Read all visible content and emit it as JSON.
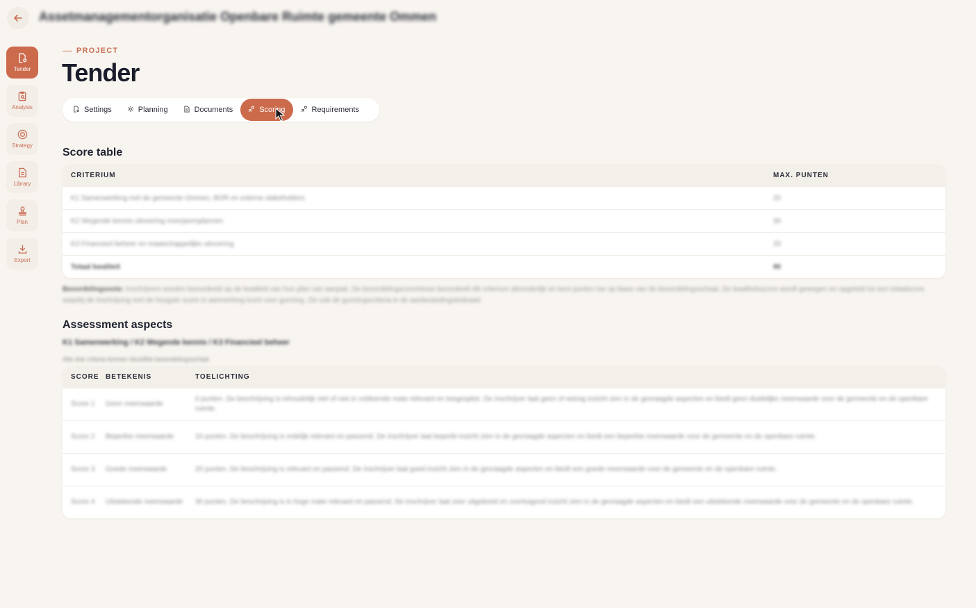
{
  "topbar": {
    "back_icon": "arrow-left-icon",
    "org_title": "Assetmanagementorganisatie Openbare Ruimte gemeente Ommen"
  },
  "sidebar": {
    "items": [
      {
        "label": "Tender",
        "icon": "document-settings-icon",
        "active": true
      },
      {
        "label": "Analysis",
        "icon": "clipboard-search-icon",
        "active": false
      },
      {
        "label": "Strategy",
        "icon": "target-icon",
        "active": false
      },
      {
        "label": "Library",
        "icon": "document-icon",
        "active": false
      },
      {
        "label": "Plan",
        "icon": "stamp-icon",
        "active": false
      },
      {
        "label": "Export",
        "icon": "download-icon",
        "active": false
      }
    ]
  },
  "header": {
    "eyebrow": "PROJECT",
    "title": "Tender"
  },
  "tabs": [
    {
      "label": "Settings",
      "icon": "document-settings-icon"
    },
    {
      "label": "Planning",
      "icon": "gear-icon"
    },
    {
      "label": "Documents",
      "icon": "document-icon"
    },
    {
      "label": "Scoring",
      "icon": "scoring-icon",
      "active": true
    },
    {
      "label": "Requirements",
      "icon": "scoring-icon"
    }
  ],
  "score_table": {
    "heading": "Score table",
    "columns": [
      "CRITERIUM",
      "MAX. PUNTEN"
    ],
    "rows": [
      {
        "criterium": "K1 Samenwerking met de gemeente Ommen, BOR en externe stakeholders",
        "punten": "20"
      },
      {
        "criterium": "K2 Wegende kennis uitvoering meerjarenplannen",
        "punten": "30"
      },
      {
        "criterium": "K3 Financieel beheer en maatschappelijke uitvoering",
        "punten": "20"
      },
      {
        "criterium": "Totaal kwaliteit",
        "punten": "90"
      }
    ]
  },
  "note": {
    "label": "Beoordelingsnote:",
    "text": " Inschrijvers worden beoordeeld op de kwaliteit van hun plan van aanpak. De beoordelingscommissie beoordeelt elk criterium afzonderlijk en kent punten toe op basis van de beoordelingsschaal. De kwaliteitsscore wordt gewogen en opgeteld tot een totaalscore waarbij de inschrijving met de hoogste score in aanmerking komt voor gunning. Zie ook de gunningscriteria in de aanbestedingsleidraad."
  },
  "assessment": {
    "heading": "Assessment aspects",
    "subtitle": "K1 Samenwerking / K2 Wegende kennis / K3 Financieel beheer",
    "description": "Alle drie criteria kennen dezelfde beoordelingsschaal",
    "columns": [
      "SCORE",
      "BETEKENIS",
      "TOELICHTING"
    ],
    "rows": [
      {
        "score": "Score 1",
        "betekenis": "Geen meerwaarde",
        "toelichting": "0 punten. De beschrijving is inhoudelijk niet of niet in voldoende mate relevant en toegespitst. De inschrijver laat geen of weinig inzicht zien in de gevraagde aspecten en biedt geen duidelijke meerwaarde voor de gemeente en de openbare ruimte."
      },
      {
        "score": "Score 2",
        "betekenis": "Beperkte meerwaarde",
        "toelichting": "10 punten. De beschrijving is redelijk relevant en passend. De inschrijver laat beperkt inzicht zien in de gevraagde aspecten en biedt een beperkte meerwaarde voor de gemeente en de openbare ruimte."
      },
      {
        "score": "Score 3",
        "betekenis": "Goede meerwaarde",
        "toelichting": "20 punten. De beschrijving is relevant en passend. De inschrijver laat goed inzicht zien in de gevraagde aspecten en biedt een goede meerwaarde voor de gemeente en de openbare ruimte."
      },
      {
        "score": "Score 4",
        "betekenis": "Uitstekende meerwaarde",
        "toelichting": "30 punten. De beschrijving is in hoge mate relevant en passend. De inschrijver laat zeer uitgebreid en overtuigend inzicht zien in de gevraagde aspecten en biedt een uitstekende meerwaarde voor de gemeente en de openbare ruimte."
      }
    ]
  },
  "colors": {
    "accent": "#cc6a4c",
    "background": "#f8f5f0"
  }
}
